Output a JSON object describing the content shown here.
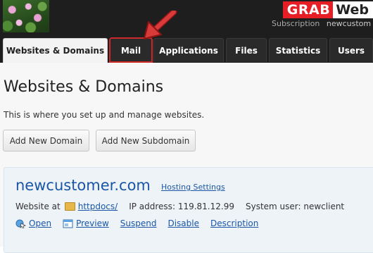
{
  "header": {
    "brand_grab": "GRAB",
    "brand_web": "Web",
    "subscription_label": "Subscription",
    "subscription_value": "newcustom"
  },
  "tabs": [
    {
      "label": "Websites & Domains",
      "active": true
    },
    {
      "label": "Mail",
      "highlighted": true
    },
    {
      "label": "Applications"
    },
    {
      "label": "Files"
    },
    {
      "label": "Statistics"
    },
    {
      "label": "Users"
    }
  ],
  "main": {
    "title": "Websites & Domains",
    "description": "This is where you set up and manage websites.",
    "add_domain_label": "Add New Domain",
    "add_subdomain_label": "Add New Subdomain"
  },
  "domain": {
    "name": "newcustomer.com",
    "hosting_settings_label": "Hosting Settings",
    "website_at_label": "Website at",
    "docroot": "httpdocs/",
    "ip_label": "IP address:",
    "ip_value": "119.81.12.99",
    "system_user_label": "System user:",
    "system_user_value": "newclient",
    "actions": {
      "open": "Open",
      "preview": "Preview",
      "suspend": "Suspend",
      "disable": "Disable",
      "description": "Description"
    }
  },
  "colors": {
    "header_bg": "#1e1e1e",
    "brand_red": "#e61e25",
    "link_blue": "#1a56a5",
    "highlight_red": "#cc2a2a"
  }
}
